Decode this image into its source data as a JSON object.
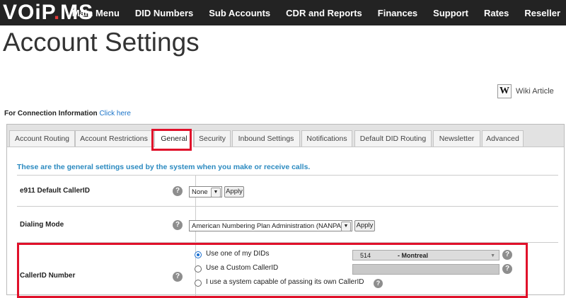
{
  "logo": {
    "part1": "VOiP",
    "part2": ".",
    "part3": "MS"
  },
  "nav": {
    "items": [
      "Main Menu",
      "DID Numbers",
      "Sub Accounts",
      "CDR and Reports",
      "Finances",
      "Support",
      "Rates",
      "Reseller"
    ]
  },
  "page_title": "Account Settings",
  "wiki": {
    "icon_letter": "W",
    "label": "Wiki Article"
  },
  "connection": {
    "label": "For Connection Information",
    "link": "Click here"
  },
  "tabs": [
    "Account Routing",
    "Account Restrictions",
    "General",
    "Security",
    "Inbound Settings",
    "Notifications",
    "Default DID Routing",
    "Newsletter",
    "Advanced"
  ],
  "active_tab": "General",
  "intro": "These are the general settings used by the system when you make or receive calls.",
  "help_glyph": "?",
  "e911": {
    "label": "e911 Default CallerID",
    "select_value": "None",
    "apply": "Apply"
  },
  "dialing": {
    "label": "Dialing Mode",
    "select_value": "American Numbering Plan Administration (NANPA)",
    "apply": "Apply"
  },
  "callerid": {
    "label": "CallerID Number",
    "options": [
      "Use one of my DIDs",
      "Use a Custom CallerID",
      "I use a system capable of passing its own CallerID"
    ],
    "selected_index": 0,
    "did_number": "514",
    "did_city": "- Montreal"
  },
  "colors": {
    "nav_bg": "#232323",
    "link": "#1a73c8",
    "intro": "#2b8ac0",
    "highlight": "#e0102a",
    "logo_accent": "#e23a3a"
  },
  "icons": {
    "dropdown": "chevron-down-icon",
    "help": "help-icon",
    "wiki": "wikipedia-icon"
  }
}
